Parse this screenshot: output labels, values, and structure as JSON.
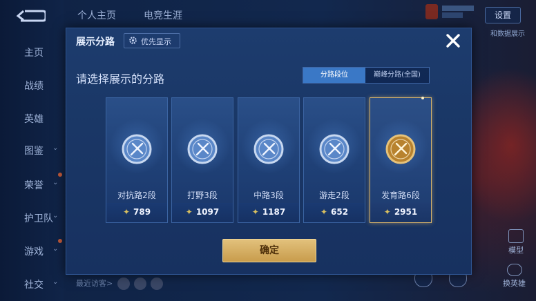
{
  "nav": {
    "items": [
      {
        "label": "主页",
        "has_chevron": false,
        "dot": false
      },
      {
        "label": "战绩",
        "has_chevron": false,
        "dot": false
      },
      {
        "label": "英雄",
        "has_chevron": false,
        "dot": false
      },
      {
        "label": "图鉴",
        "has_chevron": true,
        "dot": false
      },
      {
        "label": "荣誉",
        "has_chevron": true,
        "dot": true
      },
      {
        "label": "护卫队",
        "has_chevron": true,
        "dot": false
      },
      {
        "label": "游戏",
        "has_chevron": true,
        "dot": true
      },
      {
        "label": "社交",
        "has_chevron": true,
        "dot": false
      }
    ]
  },
  "top_tabs": [
    "个人主页",
    "电竞生涯"
  ],
  "settings_label": "设置",
  "side_text": "和数据展示",
  "recent_visitors_label": "最近访客>",
  "right_icons": {
    "model": "模型",
    "swap_hero": "换英雄"
  },
  "modal": {
    "title": "展示分路",
    "priority_button": "优先显示",
    "prompt": "请选择展示的分路",
    "tabs": [
      "分路段位",
      "巅峰分路(全国)"
    ],
    "lanes": [
      {
        "name": "对抗路2段",
        "score": "789",
        "selected": false,
        "icon": "clash-lane-icon"
      },
      {
        "name": "打野3段",
        "score": "1097",
        "selected": false,
        "icon": "jungle-icon"
      },
      {
        "name": "中路3段",
        "score": "1187",
        "selected": false,
        "icon": "mid-lane-icon"
      },
      {
        "name": "游走2段",
        "score": "652",
        "selected": false,
        "icon": "roam-icon"
      },
      {
        "name": "发育路6段",
        "score": "2951",
        "selected": true,
        "icon": "farm-lane-icon"
      }
    ],
    "confirm": "确定"
  },
  "colors": {
    "accent_gold": "#d8b46a",
    "tab_active": "#3a78c6",
    "modal_bg": "#1a3766"
  }
}
